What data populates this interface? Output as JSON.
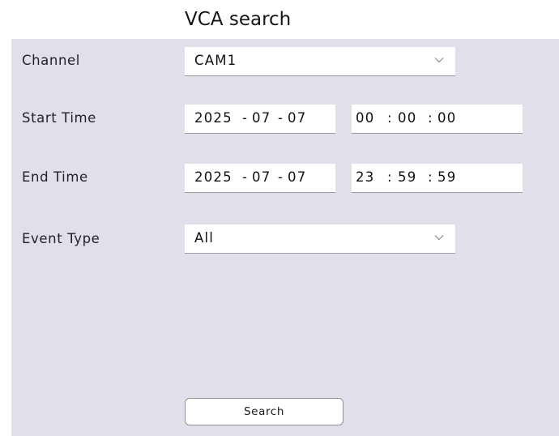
{
  "title": "VCA search",
  "form": {
    "channel": {
      "label": "Channel",
      "value": "CAM1",
      "icon": "chevron-down-icon"
    },
    "start_time": {
      "label": "Start Time",
      "year": "2025",
      "month": "07",
      "day": "07",
      "hour": "00",
      "minute": "00",
      "second": "00",
      "date_sep": "-",
      "time_sep": ":"
    },
    "end_time": {
      "label": "End Time",
      "year": "2025",
      "month": "07",
      "day": "07",
      "hour": "23",
      "minute": "59",
      "second": "59",
      "date_sep": "-",
      "time_sep": ":"
    },
    "event_type": {
      "label": "Event Type",
      "value": "All",
      "icon": "chevron-down-icon"
    }
  },
  "search_button": {
    "label": "Search"
  },
  "colors": {
    "panel_bg": "#e2dfea",
    "field_bg": "#ffffff",
    "text": "#222222"
  }
}
